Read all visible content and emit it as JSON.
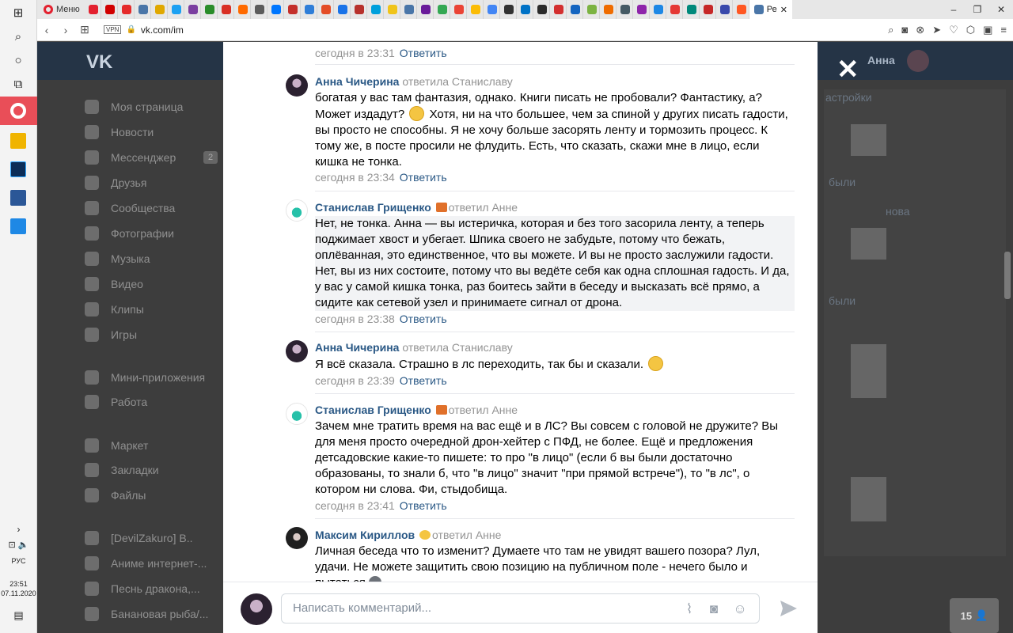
{
  "browser": {
    "menu_label": "Меню",
    "active_tab_label": "Ре",
    "url": "vk.com/im",
    "vpn_label": "VPN",
    "tab_favicon_colors": [
      "#e3212f",
      "#d10000",
      "#e52b2b",
      "#4a76a8",
      "#e0a800",
      "#1da1f2",
      "#7b3fa0",
      "#2a8d2a",
      "#d93025",
      "#ff6a00",
      "#5c5c5c",
      "#0077ff",
      "#c4302b",
      "#2f7ed8",
      "#e44d26",
      "#1a73e8",
      "#b7312c",
      "#00a0dc",
      "#f0c419",
      "#4a76a8",
      "#6a1b9a",
      "#34a853",
      "#ea4335",
      "#fbbc05",
      "#4285f4",
      "#333333",
      "#0072c6",
      "#2b2b2b",
      "#d32f2f",
      "#1565c0",
      "#7cb342",
      "#ef6c00",
      "#455a64",
      "#8e24aa",
      "#1e88e5",
      "#e53935",
      "#00897b",
      "#c62828",
      "#3949ab",
      "#ff5722"
    ],
    "system_time": "23:51",
    "system_date": "07.11.2020",
    "system_lang": "РУС",
    "window_controls": [
      "–",
      "❐",
      "✕"
    ],
    "address_tools": [
      "search-icon",
      "camera-icon",
      "pin-icon",
      "send-icon",
      "heart-icon",
      "box-icon",
      "wallet-icon",
      "settings-icon"
    ]
  },
  "vk": {
    "logo": "VK",
    "user_name": "Анна",
    "friends_count": "15",
    "menu": [
      {
        "label": "Моя страница",
        "icon": "user-icon"
      },
      {
        "label": "Новости",
        "icon": "news-icon"
      },
      {
        "label": "Мессенджер",
        "icon": "chat-icon",
        "count": "2"
      },
      {
        "label": "Друзья",
        "icon": "friends-icon"
      },
      {
        "label": "Сообщества",
        "icon": "groups-icon"
      },
      {
        "label": "Фотографии",
        "icon": "camera-icon"
      },
      {
        "label": "Музыка",
        "icon": "music-icon"
      },
      {
        "label": "Видео",
        "icon": "video-icon"
      },
      {
        "label": "Клипы",
        "icon": "clips-icon"
      },
      {
        "label": "Игры",
        "icon": "games-icon"
      },
      {
        "label": "Мини-приложения",
        "icon": "apps-icon"
      },
      {
        "label": "Работа",
        "icon": "work-icon"
      },
      {
        "label": "Маркет",
        "icon": "market-icon"
      },
      {
        "label": "Закладки",
        "icon": "bookmark-icon"
      },
      {
        "label": "Файлы",
        "icon": "file-icon"
      },
      {
        "label": "[DevilZakuro] В..",
        "icon": "group-icon"
      },
      {
        "label": "Аниме интернет-...",
        "icon": "group-icon"
      },
      {
        "label": "Песнь дракона,...",
        "icon": "group-icon"
      },
      {
        "label": "Банановая рыба/...",
        "icon": "group-icon"
      }
    ],
    "right_panel": {
      "settings_label": "астройки",
      "text_1": "были",
      "text_2": "нова",
      "text_3": "были"
    }
  },
  "thread": {
    "first_footer": {
      "time": "сегодня в 23:31",
      "reply": "Ответить"
    },
    "comments": [
      {
        "author": "Анна Чичерина",
        "replied_to": "ответила Станиславу",
        "body_before_emoji": "богатая у вас там фантазия, однако. Книги писать не пробовали? Фантастику, а? Может издадут? ",
        "body_after_emoji": " Хотя, ни на что большее, чем за спиной у других писать гадости, вы просто не способны. Я не хочу больше засорять ленту и тормозить процесс. К тому же, в посте просили не флудить. Есть, что сказать, скажи мне в лицо, если кишка не тонка.",
        "time": "сегодня в 23:34",
        "reply": "Ответить"
      },
      {
        "author": "Станислав Грищенко",
        "replied_to": "ответил Анне",
        "body": "Нет, не тонка. Анна — вы истеричка, которая и без того засорила ленту, а теперь поджимает хвост и убегает. Шпика своего не забудьте, потому что бежать, оплёванная, это единственное, что вы можете. И вы не просто заслужили гадости. Нет, вы из них состоите, потому что вы ведёте себя как одна сплошная гадость. И да, у вас у самой кишка тонка, раз боитесь зайти в беседу и высказать всё прямо, а сидите как сетевой узел и принимаете сигнал от дрона.",
        "time": "сегодня в 23:38",
        "reply": "Ответить"
      },
      {
        "author": "Анна Чичерина",
        "replied_to": "ответила Станиславу",
        "body": "Я всё сказала. Страшно в лс переходить, так бы и сказали. ",
        "time": "сегодня в 23:39",
        "reply": "Ответить"
      },
      {
        "author": "Станислав Грищенко",
        "replied_to": "ответил Анне",
        "body": "Зачем мне тратить время на вас ещё и в ЛС? Вы совсем с головой не дружите? Вы для меня просто очередной дрон-хейтер с ПФД, не более. Ещё и предложения детсадовские какие-то пишете: то про \"в лицо\" (если б вы были достаточно образованы, то знали б, что \"в лицо\" значит \"при прямой встрече\"), то \"в лс\", о котором ни слова. Фи, стыдобища.",
        "time": "сегодня в 23:41",
        "reply": "Ответить"
      },
      {
        "author": "Максим Кириллов",
        "replied_to": "ответил Анне",
        "body": "Личная беседа что то изменит? Думаете что там не увидят вашего позора? Лул, удачи. Не можете защитить свою позицию на публичном поле - нечего было и пытаться"
      }
    ],
    "composer_placeholder": "Написать комментарий..."
  }
}
